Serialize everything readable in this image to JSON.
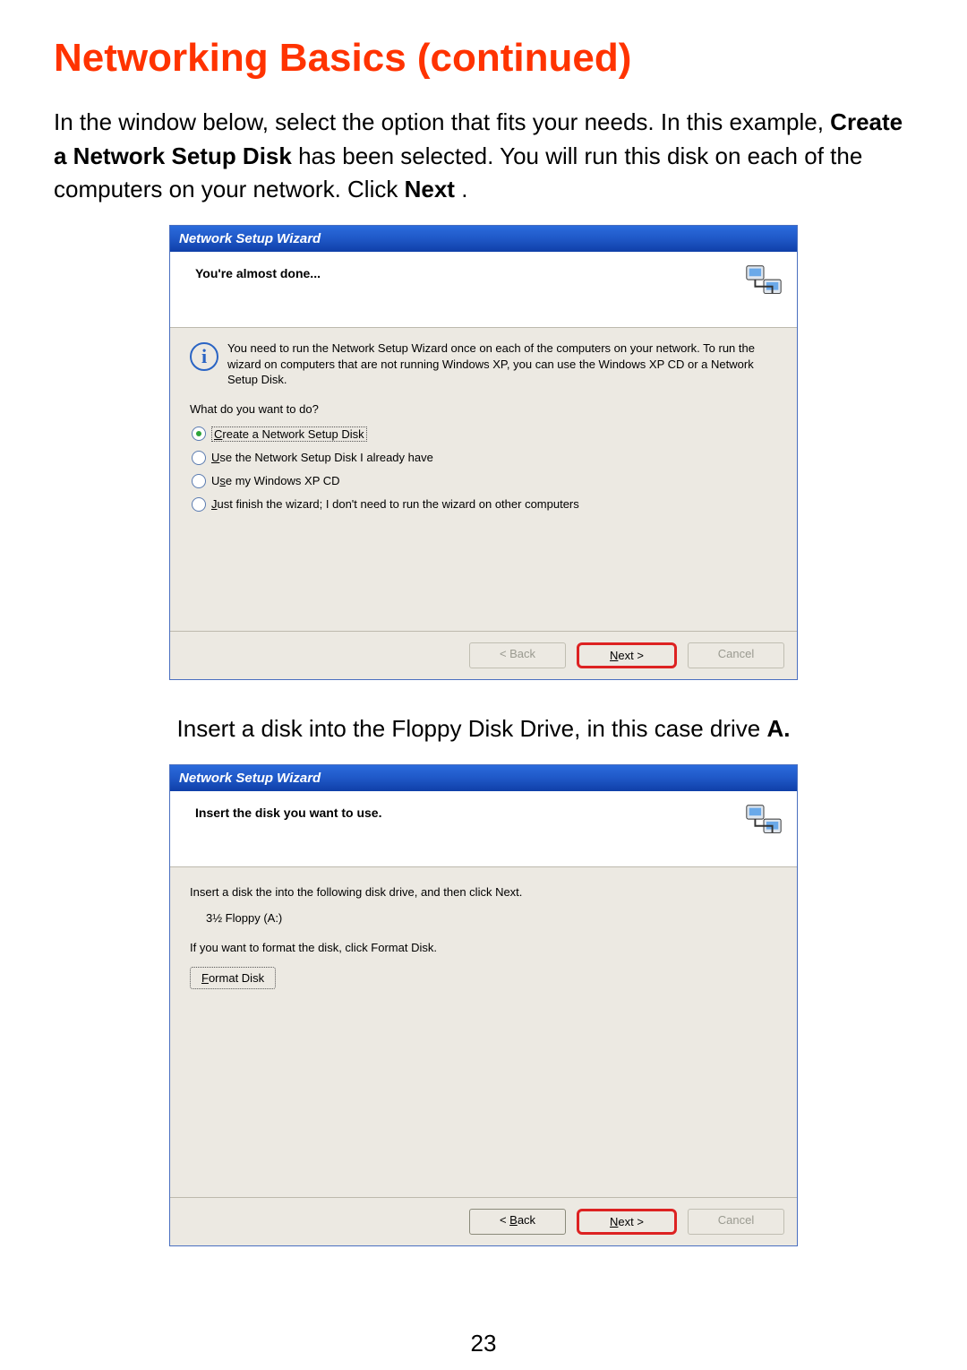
{
  "page": {
    "heading": "Networking Basics (continued)",
    "intro_pre": "In the window below, select the option that fits your needs.  In this example, ",
    "intro_bold1": "Create a Network Setup Disk",
    "intro_mid": " has been selected.  You will run this disk on each of the computers on your network. Click ",
    "intro_bold2": "Next",
    "intro_end": ".",
    "mid_pre": "Insert a disk into the Floppy Disk Drive, in this case drive ",
    "mid_bold": "A.",
    "pagenum": "23"
  },
  "wiz1": {
    "title": "Network Setup Wizard",
    "header": "You're almost done...",
    "info": "You need to run the Network Setup Wizard once on each of the computers on your network. To run the wizard on computers that are not running Windows XP, you can use the Windows XP CD or a Network Setup Disk.",
    "prompt": "What do you want to do?",
    "opts": {
      "o1a": "C",
      "o1b": "reate a Network Setup Disk",
      "o2a": "U",
      "o2b": "se the Network Setup Disk I already have",
      "o3a": "s",
      "o3pre": "U",
      "o3b": "e my Windows XP CD",
      "o4a": "J",
      "o4b": "ust finish the wizard; I don't need to run the wizard on other computers"
    },
    "buttons": {
      "back": "< Back",
      "next": "Next >",
      "cancel": "Cancel"
    }
  },
  "wiz2": {
    "title": "Network Setup Wizard",
    "header": "Insert the disk you want to use.",
    "line1": "Insert a disk the into the following disk drive, and then click Next.",
    "drive": "3½ Floppy (A:)",
    "line2": "If you want to format the disk, click Format Disk.",
    "format_u": "F",
    "format_rest": "ormat Disk",
    "buttons": {
      "back_u": "B",
      "back_pre": "< ",
      "back_post": "ack",
      "next_u": "N",
      "next_post": "ext >",
      "cancel": "Cancel"
    }
  }
}
